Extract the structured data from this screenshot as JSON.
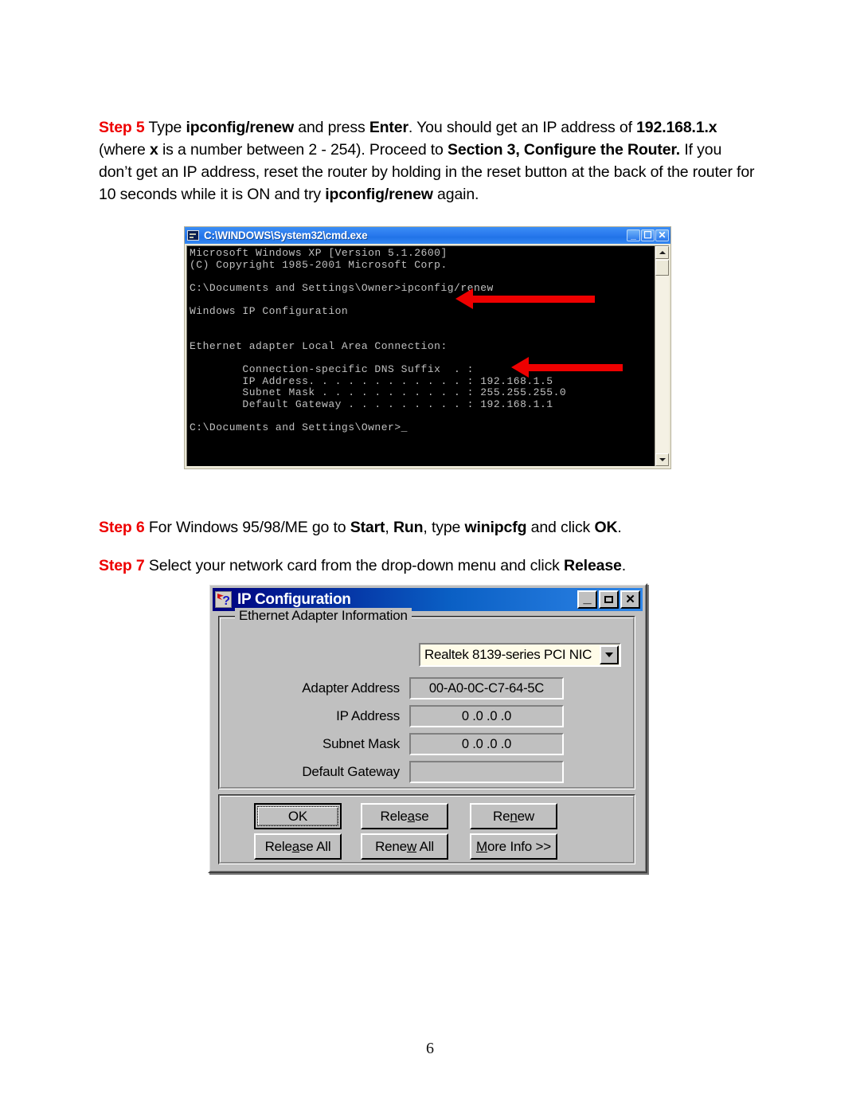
{
  "document": {
    "page_number": "6",
    "paragraphs": {
      "step5": {
        "step_label": "Step 5",
        "runs": [
          {
            "text": " Type ",
            "bold": false
          },
          {
            "text": "ipconfig/renew",
            "bold": true
          },
          {
            "text": " and press ",
            "bold": false
          },
          {
            "text": "Enter",
            "bold": true
          },
          {
            "text": ". You should get an IP address of ",
            "bold": false
          },
          {
            "text": "192.168.1.x",
            "bold": true
          },
          {
            "text": " (where ",
            "bold": false
          },
          {
            "text": "x",
            "bold": true
          },
          {
            "text": " is a number between 2 - 254). Proceed to ",
            "bold": false
          },
          {
            "text": "Section 3, Configure the Router.",
            "bold": true
          },
          {
            "text": " If you don’t get an IP address, reset the router by holding in the reset button at the back of the router for 10 seconds while it is ON and try ",
            "bold": false
          },
          {
            "text": "ipconfig/renew",
            "bold": true
          },
          {
            "text": " again.",
            "bold": false
          }
        ]
      },
      "step6": {
        "step_label": "Step 6",
        "runs": [
          {
            "text": " For Windows 95/98/ME go to ",
            "bold": false
          },
          {
            "text": "Start",
            "bold": true
          },
          {
            "text": ", ",
            "bold": false
          },
          {
            "text": "Run",
            "bold": true
          },
          {
            "text": ", type ",
            "bold": false
          },
          {
            "text": "winipcfg",
            "bold": true
          },
          {
            "text": " and click ",
            "bold": false
          },
          {
            "text": "OK",
            "bold": true
          },
          {
            "text": ".",
            "bold": false
          }
        ]
      },
      "step7": {
        "step_label": "Step 7",
        "runs": [
          {
            "text": " Select your network card from the drop-down menu and click ",
            "bold": false
          },
          {
            "text": "Release",
            "bold": true
          },
          {
            "text": ".",
            "bold": false
          }
        ]
      }
    }
  },
  "cmd_window": {
    "title": "C:\\WINDOWS\\System32\\cmd.exe",
    "icon": "cmd-console-icon",
    "controls": [
      {
        "name": "minimize",
        "glyph": "–"
      },
      {
        "name": "maximize",
        "glyph": "❐"
      },
      {
        "name": "close",
        "glyph": "×"
      }
    ],
    "console_text": "Microsoft Windows XP [Version 5.1.2600]\n(C) Copyright 1985-2001 Microsoft Corp.\n\nC:\\Documents and Settings\\Owner>ipconfig/renew\n\nWindows IP Configuration\n\n\nEthernet adapter Local Area Connection:\n\n        Connection-specific DNS Suffix  . :\n        IP Address. . . . . . . . . . . . : 192.168.1.5\n        Subnet Mask . . . . . . . . . . . : 255.255.255.0\n        Default Gateway . . . . . . . . . : 192.168.1.1\n\nC:\\Documents and Settings\\Owner>_",
    "annotations": [
      {
        "name": "arrow-to-command-line",
        "color": "#ee0000"
      },
      {
        "name": "arrow-to-ip-address",
        "color": "#ee0000"
      }
    ],
    "scrollbar": {
      "up": "▲",
      "down": "▼"
    }
  },
  "ipconfig_dialog": {
    "title": "IP Configuration",
    "icon": "network-help-icon",
    "controls": [
      {
        "name": "minimize",
        "glyph": "_"
      },
      {
        "name": "maximize",
        "glyph": ""
      },
      {
        "name": "close",
        "glyph": "✕"
      }
    ],
    "group_legend": "Ethernet  Adapter Information",
    "adapter_combo": {
      "selected": "Realtek 8139-series PCI NIC",
      "options": [
        "Realtek 8139-series PCI NIC"
      ]
    },
    "fields": [
      {
        "label": "Adapter Address",
        "value": "00-A0-0C-C7-64-5C"
      },
      {
        "label": "IP Address",
        "value": "0 .0 .0 .0"
      },
      {
        "label": "Subnet Mask",
        "value": "0 .0 .0 .0"
      },
      {
        "label": "Default Gateway",
        "value": ""
      }
    ],
    "buttons": [
      {
        "name": "ok",
        "label": "OK",
        "default": true
      },
      {
        "name": "release",
        "label": "Release",
        "accel": "a"
      },
      {
        "name": "renew",
        "label": "Renew",
        "accel": "n"
      },
      {
        "name": "release-all",
        "label": "Release All",
        "accel": "a"
      },
      {
        "name": "renew-all",
        "label": "Renew All",
        "accel": "w"
      },
      {
        "name": "more-info",
        "label": "More Info >>",
        "accel": "M"
      }
    ]
  }
}
